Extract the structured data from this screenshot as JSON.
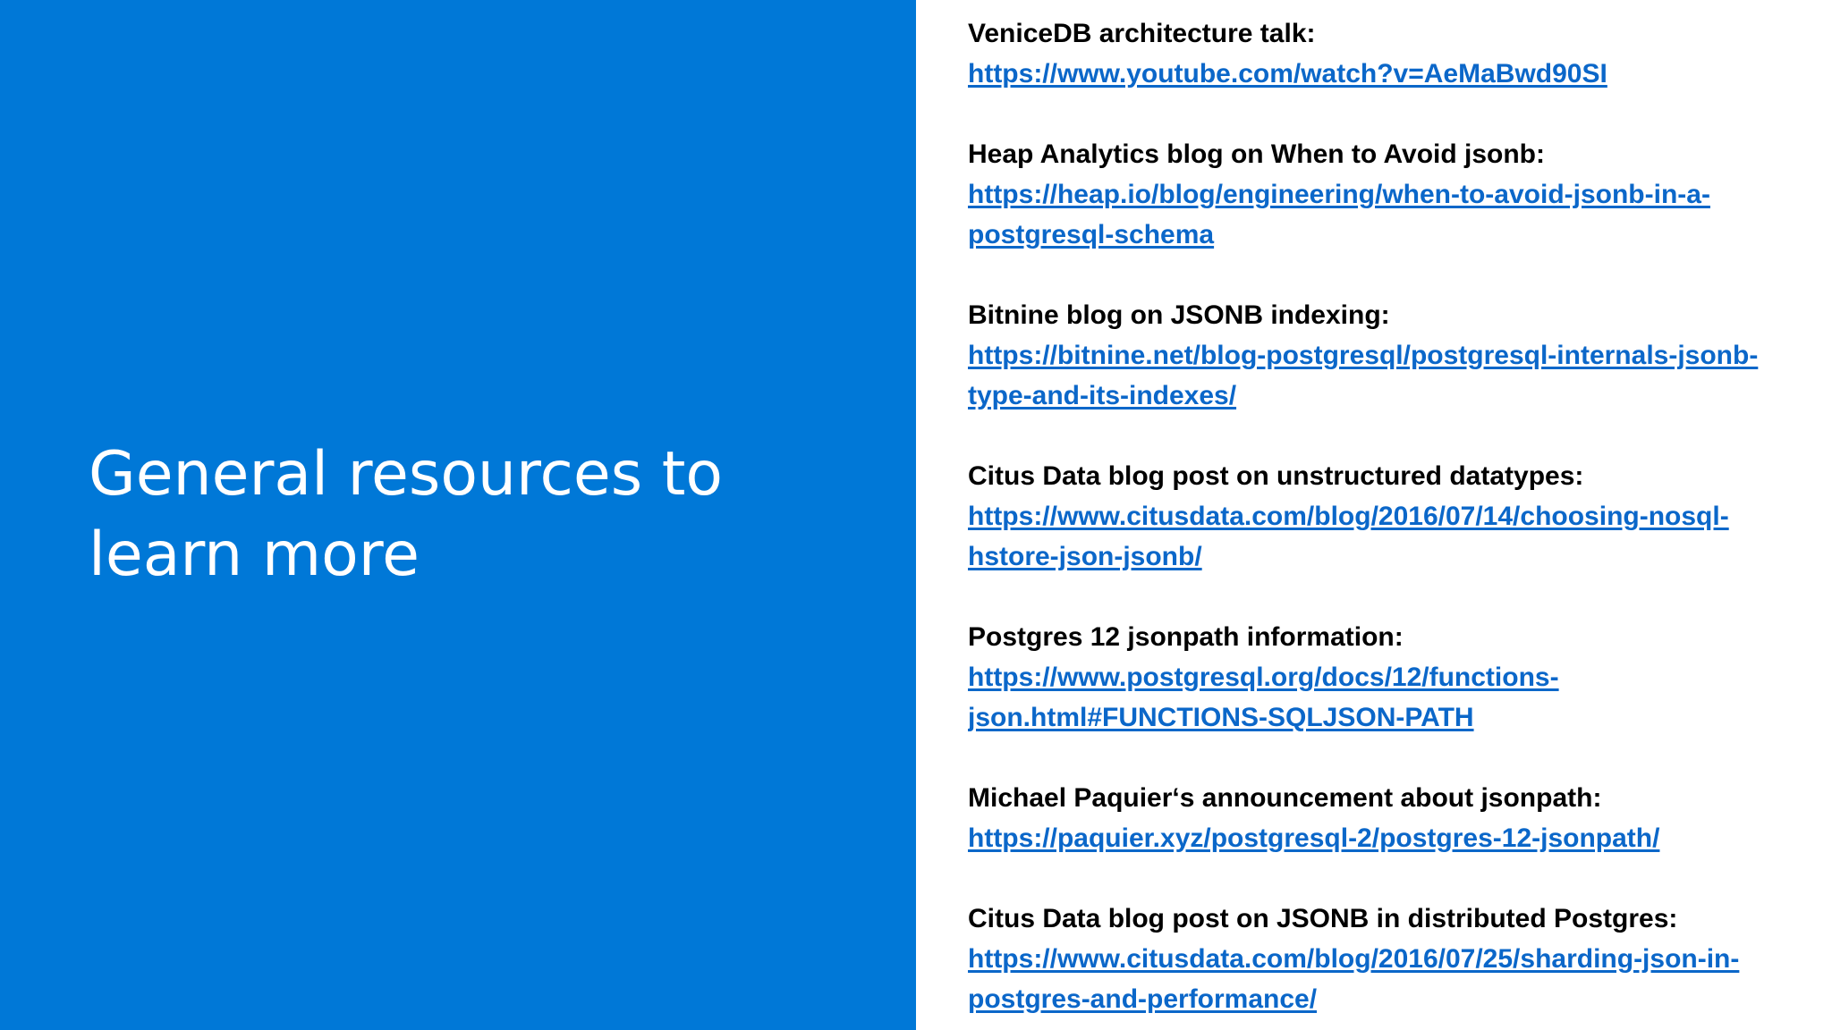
{
  "slide": {
    "title": "General resources to\nlearn more"
  },
  "resources": [
    {
      "title": "VeniceDB architecture talk:",
      "url": "https://www.youtube.com/watch?v=AeMaBwd90SI"
    },
    {
      "title": "Heap Analytics blog on When to Avoid jsonb:",
      "url": "https://heap.io/blog/engineering/when-to-avoid-jsonb-in-a-\npostgresql-schema"
    },
    {
      "title": "Bitnine blog on JSONB indexing:",
      "url": "https://bitnine.net/blog-postgresql/postgresql-internals-jsonb-\ntype-and-its-indexes/"
    },
    {
      "title": "Citus Data blog post on unstructured datatypes:",
      "url": "https://www.citusdata.com/blog/2016/07/14/choosing-nosql-\nhstore-json-jsonb/"
    },
    {
      "title": "Postgres 12 jsonpath information:",
      "url": "https://www.postgresql.org/docs/12/functions-\njson.html#FUNCTIONS-SQLJSON-PATH"
    },
    {
      "title": "Michael Paquier‘s announcement about jsonpath:",
      "url": "https://paquier.xyz/postgresql-2/postgres-12-jsonpath/"
    },
    {
      "title": "Citus Data blog post on JSONB in distributed Postgres:",
      "url": "https://www.citusdata.com/blog/2016/07/25/sharding-json-in-\npostgres-and-performance/"
    }
  ],
  "colors": {
    "accent_blue": "#0078d7",
    "link_blue": "#0b67c9",
    "text_black": "#000000",
    "background": "#ffffff"
  }
}
